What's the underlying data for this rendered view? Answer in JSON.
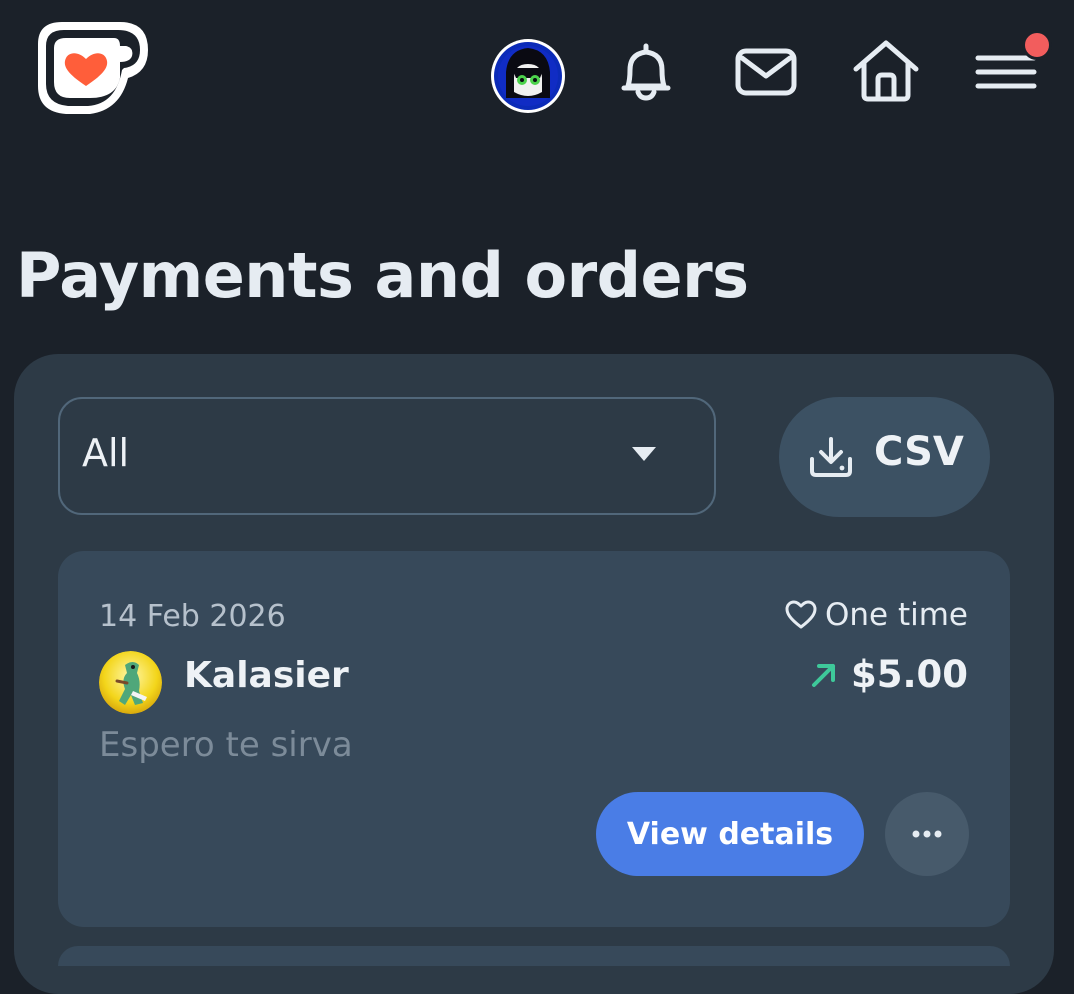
{
  "header": {
    "logo_icon": "ko-fi-cup-heart-logo",
    "avatar_icon": "user-avatar",
    "notifications_icon": "bell-icon",
    "messages_icon": "mail-icon",
    "home_icon": "home-icon",
    "menu_icon": "hamburger-menu-icon",
    "menu_has_notification": true,
    "notification_dot_color": "#f25d5d"
  },
  "page": {
    "title": "Payments and orders"
  },
  "filters": {
    "type_select": {
      "selected": "All",
      "icon": "caret-down-icon"
    },
    "csv_button": {
      "label": "CSV",
      "icon": "download-tray-icon"
    }
  },
  "payments": [
    {
      "date": "14 Feb 2026",
      "type_label": "One time",
      "type_icon": "heart-outline-icon",
      "supporter_name": "Kalasier",
      "supporter_avatar_icon": "supporter-avatar",
      "direction_icon": "arrow-up-right-icon",
      "direction_color": "#3ec99a",
      "amount": "$5.00",
      "message": "Espero te sirva",
      "view_button_label": "View details",
      "more_icon": "ellipsis-icon"
    }
  ],
  "colors": {
    "background": "#1b2129",
    "panel": "#2d3a46",
    "card": "#37495a",
    "primary_button": "#4a7de6",
    "logo_heart": "#ff5e3a"
  }
}
